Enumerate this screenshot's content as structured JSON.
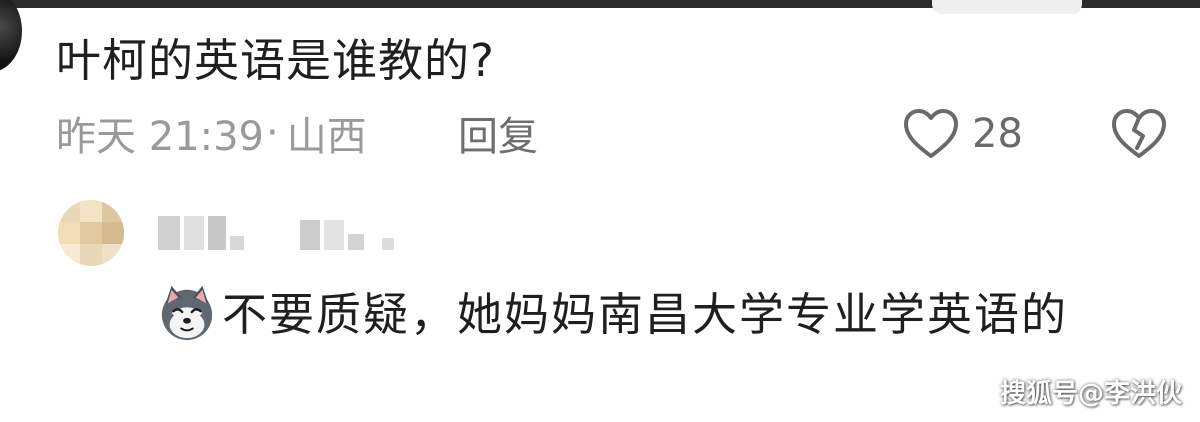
{
  "comment": {
    "text": "叶柯的英语是谁教的?",
    "time": "昨天 21:39",
    "location": "山西",
    "separator": "·",
    "reply_label": "回复",
    "like_count": "28"
  },
  "reply": {
    "emoji": "dog-face-emoji",
    "text": "不要质疑，她妈妈南昌大学专业学英语的"
  },
  "icons": {
    "like": "heart-outline-icon",
    "dislike": "broken-heart-icon"
  },
  "watermark": {
    "text": "搜狐号@李洪伙"
  },
  "colors": {
    "primary_text": "#1f1f1f",
    "meta_text": "#9a9a9a",
    "icon_gray": "#6a6a6a"
  }
}
